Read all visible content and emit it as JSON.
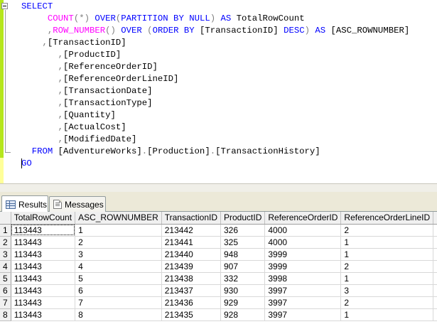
{
  "editor": {
    "lines": [
      [
        {
          "t": "SELECT",
          "c": "kw"
        }
      ],
      [
        {
          "t": "     "
        },
        {
          "t": "COUNT",
          "c": "fn"
        },
        {
          "t": "(*)",
          "c": "op"
        },
        {
          "t": " "
        },
        {
          "t": "OVER",
          "c": "kw"
        },
        {
          "t": "(",
          "c": "op"
        },
        {
          "t": "PARTITION BY NULL",
          "c": "kw"
        },
        {
          "t": ")",
          "c": "op"
        },
        {
          "t": " "
        },
        {
          "t": "AS",
          "c": "kw"
        },
        {
          "t": " TotalRowCount"
        }
      ],
      [
        {
          "t": "     "
        },
        {
          "t": ",",
          "c": "op"
        },
        {
          "t": "ROW_NUMBER",
          "c": "fn"
        },
        {
          "t": "()",
          "c": "op"
        },
        {
          "t": " "
        },
        {
          "t": "OVER",
          "c": "kw"
        },
        {
          "t": " "
        },
        {
          "t": "(",
          "c": "op"
        },
        {
          "t": "ORDER BY",
          "c": "kw"
        },
        {
          "t": " [TransactionID] "
        },
        {
          "t": "DESC",
          "c": "kw"
        },
        {
          "t": ")",
          "c": "op"
        },
        {
          "t": " "
        },
        {
          "t": "AS",
          "c": "kw"
        },
        {
          "t": " [ASC_ROWNUMBER]"
        }
      ],
      [
        {
          "t": "    "
        },
        {
          "t": ",",
          "c": "op"
        },
        {
          "t": "[TransactionID]"
        }
      ],
      [
        {
          "t": "       "
        },
        {
          "t": ",",
          "c": "op"
        },
        {
          "t": "[ProductID]"
        }
      ],
      [
        {
          "t": "       "
        },
        {
          "t": ",",
          "c": "op"
        },
        {
          "t": "[ReferenceOrderID]"
        }
      ],
      [
        {
          "t": "       "
        },
        {
          "t": ",",
          "c": "op"
        },
        {
          "t": "[ReferenceOrderLineID]"
        }
      ],
      [
        {
          "t": "       "
        },
        {
          "t": ",",
          "c": "op"
        },
        {
          "t": "[TransactionDate]"
        }
      ],
      [
        {
          "t": "       "
        },
        {
          "t": ",",
          "c": "op"
        },
        {
          "t": "[TransactionType]"
        }
      ],
      [
        {
          "t": "       "
        },
        {
          "t": ",",
          "c": "op"
        },
        {
          "t": "[Quantity]"
        }
      ],
      [
        {
          "t": "       "
        },
        {
          "t": ",",
          "c": "op"
        },
        {
          "t": "[ActualCost]"
        }
      ],
      [
        {
          "t": "       "
        },
        {
          "t": ",",
          "c": "op"
        },
        {
          "t": "[ModifiedDate]"
        }
      ],
      [
        {
          "t": "  "
        },
        {
          "t": "FROM",
          "c": "kw"
        },
        {
          "t": " [AdventureWorks]"
        },
        {
          "t": ".",
          "c": "op"
        },
        {
          "t": "[Production]"
        },
        {
          "t": ".",
          "c": "op"
        },
        {
          "t": "[TransactionHistory]"
        }
      ],
      [
        {
          "t": "GO",
          "c": "kw"
        }
      ]
    ]
  },
  "tabs": {
    "results_label": "Results",
    "messages_label": "Messages"
  },
  "grid": {
    "columns": [
      "TotalRowCount",
      "ASC_ROWNUMBER",
      "TransactionID",
      "ProductID",
      "ReferenceOrderID",
      "ReferenceOrderLineID"
    ],
    "rows": [
      {
        "n": "1",
        "cells": [
          "113443",
          "1",
          "213442",
          "326",
          "4000",
          "2"
        ]
      },
      {
        "n": "2",
        "cells": [
          "113443",
          "2",
          "213441",
          "325",
          "4000",
          "1"
        ]
      },
      {
        "n": "3",
        "cells": [
          "113443",
          "3",
          "213440",
          "948",
          "3999",
          "1"
        ]
      },
      {
        "n": "4",
        "cells": [
          "113443",
          "4",
          "213439",
          "907",
          "3999",
          "2"
        ]
      },
      {
        "n": "5",
        "cells": [
          "113443",
          "5",
          "213438",
          "332",
          "3998",
          "1"
        ]
      },
      {
        "n": "6",
        "cells": [
          "113443",
          "6",
          "213437",
          "930",
          "3997",
          "3"
        ]
      },
      {
        "n": "7",
        "cells": [
          "113443",
          "7",
          "213436",
          "929",
          "3997",
          "2"
        ]
      },
      {
        "n": "8",
        "cells": [
          "113443",
          "8",
          "213435",
          "928",
          "3997",
          "1"
        ]
      }
    ]
  }
}
